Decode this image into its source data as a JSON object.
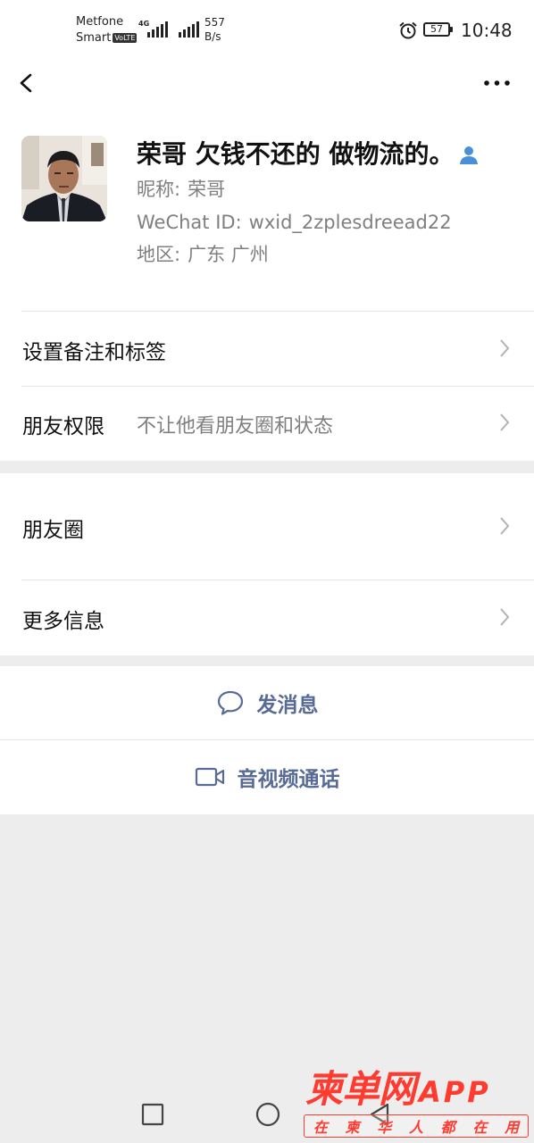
{
  "status_bar": {
    "carrier_line1": "Metfone",
    "carrier_line2": "Smart",
    "volte_badge": "VoLTE",
    "network_gen": "4G",
    "net_speed_value": "557",
    "net_speed_unit": "B/s",
    "battery_level": "57",
    "time": "10:48"
  },
  "nav": {
    "back_icon": "chevron-left-icon",
    "more_icon": "more-dots-icon"
  },
  "profile": {
    "remark_name": "荣哥 欠钱不还的 做物流的。",
    "nickname_label": "昵称:",
    "nickname": "荣哥",
    "wechat_id_label": "WeChat ID:",
    "wechat_id": "wxid_2zplesdreead22",
    "region_label": "地区:",
    "region": "广东  广州"
  },
  "settings_group": {
    "remarks_tags_label": "设置备注和标签",
    "friend_permissions_label": "朋友权限",
    "friend_permissions_value": "不让他看朋友圈和状态"
  },
  "moments_group": {
    "moments_label": "朋友圈",
    "more_info_label": "更多信息"
  },
  "actions": {
    "send_message_label": "发消息",
    "voice_video_call_label": "音视频通话"
  },
  "watermark": {
    "title": "柬单网",
    "app": "APP",
    "slogan": [
      "在",
      "柬",
      "华",
      "人",
      "都",
      "在",
      "用"
    ]
  },
  "colors": {
    "background": "#ededed",
    "link_blue": "#576b95",
    "verified_icon_blue": "#4a90d9",
    "watermark_red": "#ff3b30"
  }
}
